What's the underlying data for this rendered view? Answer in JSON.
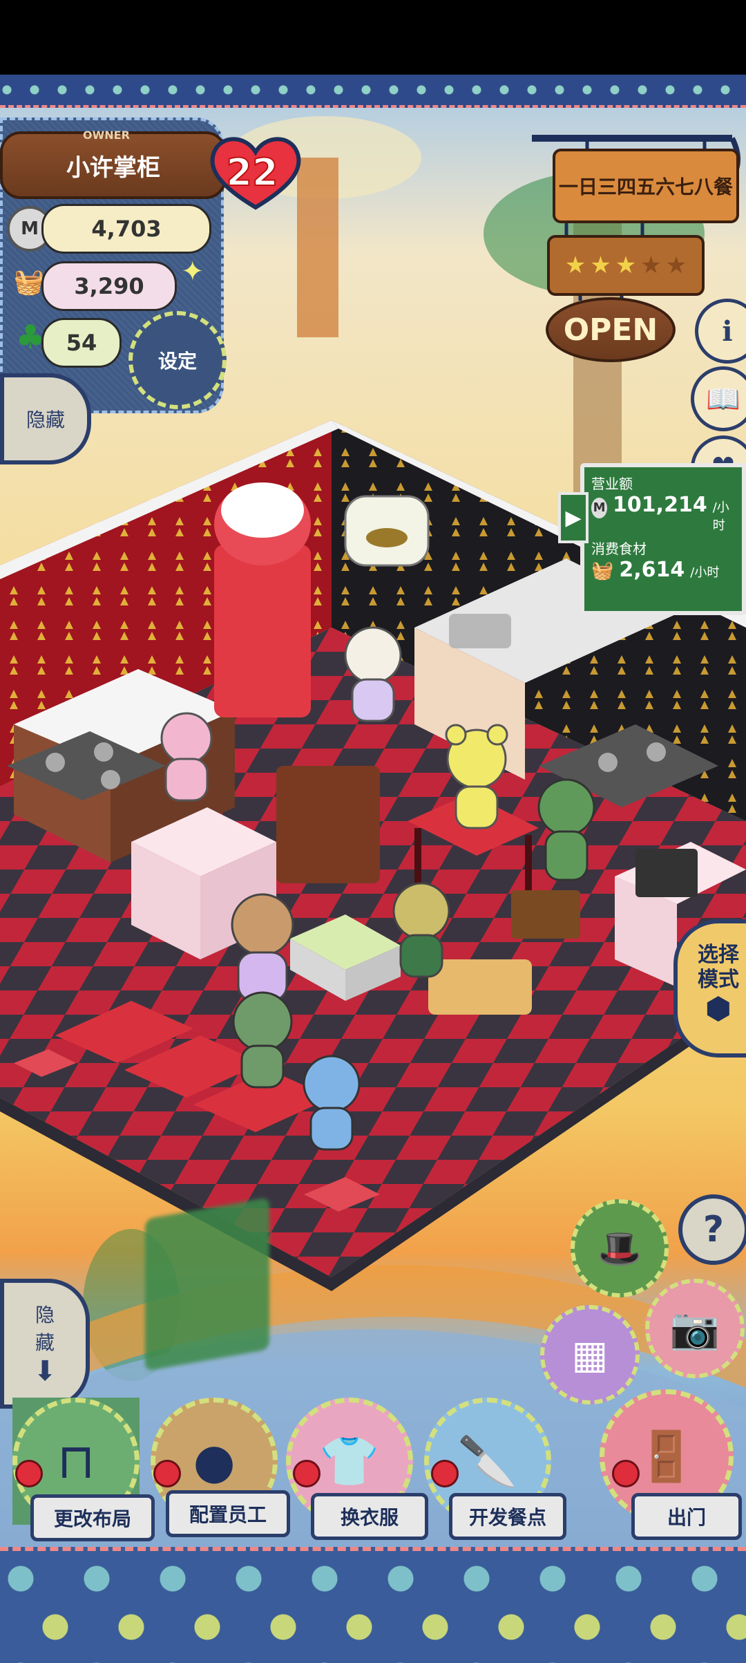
{
  "owner": {
    "title": "OWNER",
    "name": "小许掌柜",
    "level": "22"
  },
  "stats": {
    "money": "4,703",
    "food": "3,290",
    "clovers": "54",
    "coin_symbol": "M"
  },
  "buttons": {
    "settings": "设定",
    "hide_top": "隐藏",
    "hide_bottom_line1": "隐",
    "hide_bottom_line2": "藏",
    "select_mode_line1": "选择",
    "select_mode_line2": "模式",
    "help": "?",
    "info": "i"
  },
  "signs": {
    "days": "一日三四五六七八餐",
    "open": "OPEN",
    "rating": 3,
    "rating_max": 5
  },
  "sales_board": {
    "revenue_label": "营业额",
    "revenue_value": "101,214",
    "revenue_unit": "/小时",
    "food_label": "消费食材",
    "food_value": "2,614",
    "food_unit": "/小时"
  },
  "bottom_menu": [
    {
      "label": "更改布局",
      "icon": "table-icon"
    },
    {
      "label": "配置员工",
      "icon": "bear-head-icon"
    },
    {
      "label": "换衣服",
      "icon": "shirt-icon"
    },
    {
      "label": "开发餐点",
      "icon": "knife-icon"
    },
    {
      "label": "出门",
      "icon": "door-icon"
    }
  ],
  "colors": {
    "denim": "#3e5a86",
    "stitch": "#d3e07d",
    "wood": "#8b4f2b",
    "board": "#2e7a3e",
    "floor_red": "#c2263a",
    "floor_dark": "#3a3440"
  }
}
